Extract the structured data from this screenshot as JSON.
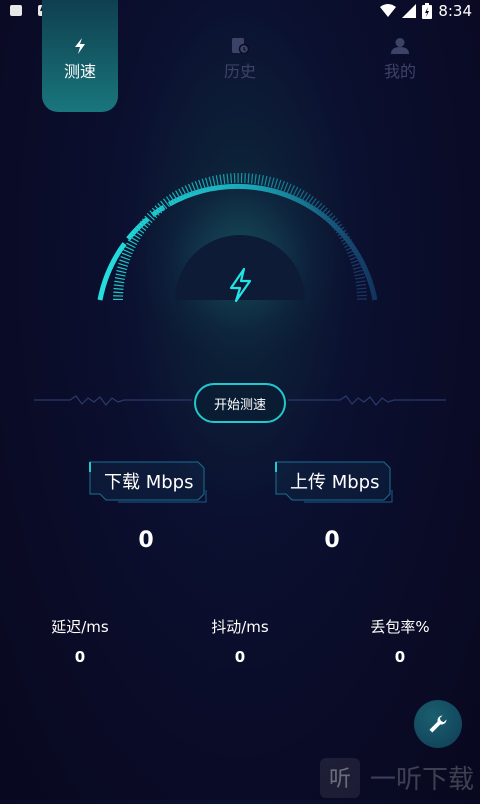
{
  "status_bar": {
    "time": "8:34"
  },
  "tabs": [
    {
      "label": "测速",
      "icon": "bolt-icon",
      "active": true
    },
    {
      "label": "历史",
      "icon": "history-icon",
      "active": false
    },
    {
      "label": "我的",
      "icon": "person-icon",
      "active": false
    }
  ],
  "actions": {
    "start_label": "开始测速"
  },
  "download": {
    "label": "下载 Mbps",
    "value": "0"
  },
  "upload": {
    "label": "上传 Mbps",
    "value": "0"
  },
  "stats": [
    {
      "label": "延迟/ms",
      "value": "0"
    },
    {
      "label": "抖动/ms",
      "value": "0"
    },
    {
      "label": "丢包率%",
      "value": "0"
    }
  ],
  "fab": {
    "icon": "wrench-icon"
  },
  "watermark": {
    "text": "一听下载"
  },
  "colors": {
    "accent": "#23c8cf",
    "background": "#0a0b26",
    "inactive": "#3d4366"
  }
}
